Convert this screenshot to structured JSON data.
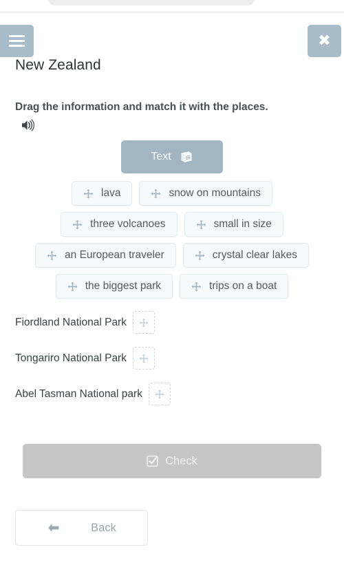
{
  "header": {
    "menu_icon": "hamburger-icon",
    "close_icon": "close-icon",
    "title": "New Zealand"
  },
  "instruction": {
    "text": "Drag the information and match it with the places.",
    "audio_icon": "speaker-icon"
  },
  "text_button": {
    "label": "Text",
    "icon": "book-icon"
  },
  "drag_items": [
    [
      {
        "label": "lava",
        "icon": "move-icon"
      },
      {
        "label": "snow on mountains",
        "icon": "move-icon"
      }
    ],
    [
      {
        "label": "three volcanoes",
        "icon": "move-icon"
      },
      {
        "label": "small in size",
        "icon": "move-icon"
      }
    ],
    [
      {
        "label": "an European traveler",
        "icon": "move-icon"
      },
      {
        "label": "crystal clear lakes",
        "icon": "move-icon"
      }
    ],
    [
      {
        "label": "the biggest park",
        "icon": "move-icon"
      },
      {
        "label": "trips on a boat",
        "icon": "move-icon"
      }
    ]
  ],
  "match_rows": [
    {
      "label": "Fiordland National Park",
      "dropzone_icon": "move-icon",
      "dropzone_value": ""
    },
    {
      "label": "Tongariro National Park",
      "dropzone_icon": "move-icon",
      "dropzone_value": ""
    },
    {
      "label": "Abel Tasman National park",
      "dropzone_icon": "move-icon",
      "dropzone_value": ""
    }
  ],
  "check_button": {
    "label": "Check",
    "icon": "checkbox-icon",
    "enabled": false
  },
  "back_button": {
    "label": "Back",
    "icon": "arrow-left-icon"
  },
  "colors": {
    "header_button_bg": "#a9bcc9",
    "text_button_bg": "#a2b5c3",
    "chip_bg": "#f7fafb",
    "chip_border": "#e3e9ec",
    "check_disabled_bg": "#c6c6c6",
    "body_text": "#4a5055",
    "page_bg": "#ffffff"
  }
}
